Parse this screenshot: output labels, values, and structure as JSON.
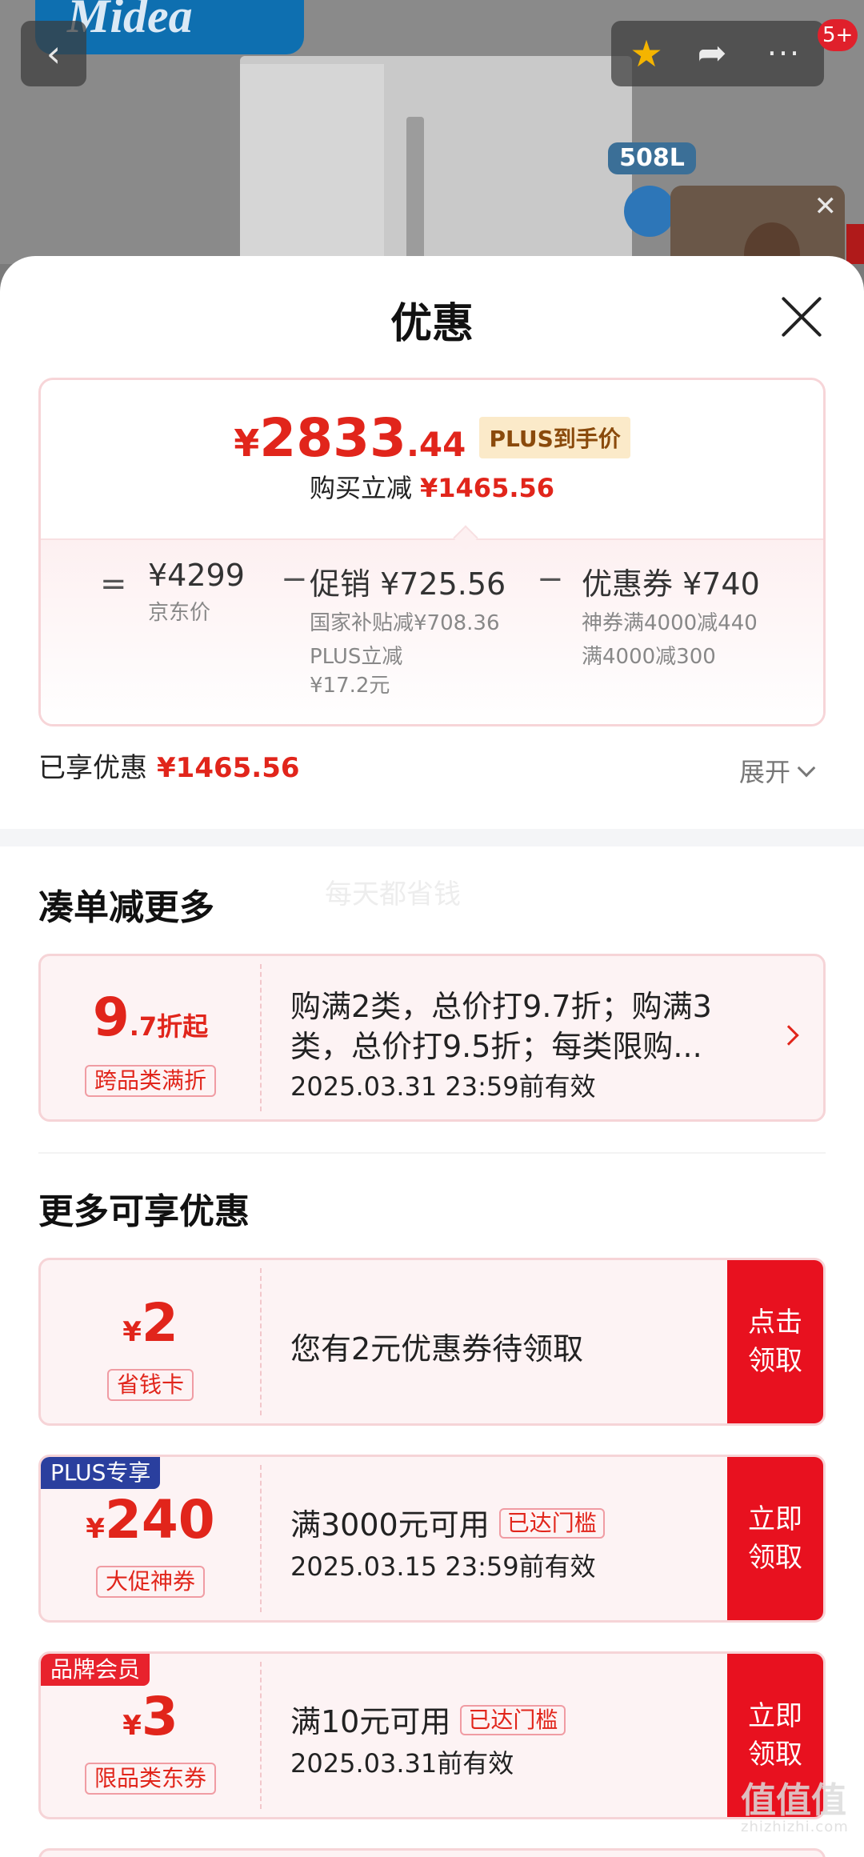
{
  "background": {
    "brand": "Midea",
    "capacity": "508L",
    "notification_count": "5+"
  },
  "sheet": {
    "title": "优惠",
    "price": {
      "symbol": "¥",
      "integer": "2833",
      "decimal": ".44",
      "plus_tag": "PLUS到手价",
      "reduce_label": "购买立减",
      "reduce_amount": "¥1465.56"
    },
    "breakdown": {
      "eq": "=",
      "minus": "−",
      "jd_price": "¥4299",
      "jd_label": "京东价",
      "promo_title": "促销 ¥725.56",
      "promo_details": [
        "国家补贴减¥708.36",
        "PLUS立减",
        "¥17.2元"
      ],
      "coupon_title": "优惠券 ¥740",
      "coupon_details": [
        "神券满4000减440",
        "满4000减300"
      ]
    },
    "enjoyed_label": "已享优惠",
    "enjoyed_amount": "¥1465.56",
    "expand_label": "展开"
  },
  "bundle": {
    "title": "凑单减更多",
    "watermark": "每天都省钱",
    "offer": {
      "value_big": "9",
      "value_small": ".7折起",
      "kind": "跨品类满折",
      "desc_line1": "购满2类，总价打9.7折；购满3",
      "desc_line2": "类，总价打9.5折；每类限购...",
      "validity": "2025.03.31 23:59前有效"
    }
  },
  "more": {
    "title": "更多可享优惠",
    "coupons": [
      {
        "tag": "",
        "symbol": "¥",
        "value": "2",
        "kind": "省钱卡",
        "desc": "您有2元优惠券待领取",
        "reached": "",
        "validity": "",
        "cta": "点击领取"
      },
      {
        "tag": "PLUS专享",
        "symbol": "¥",
        "value": "240",
        "kind": "大促神券",
        "desc": "满3000元可用",
        "reached": "已达门槛",
        "validity": "2025.03.15 23:59前有效",
        "cta": "立即领取"
      },
      {
        "tag": "品牌会员",
        "symbol": "¥",
        "value": "3",
        "kind": "限品类东券",
        "desc": "满10元可用",
        "reached": "已达门槛",
        "validity": "2025.03.31前有效",
        "cta": "立即领取"
      }
    ]
  },
  "site_mark": {
    "cn": "值值值",
    "en": "zhizhizhi.com"
  },
  "colors": {
    "accent": "#e1251b",
    "cta": "#e8111f",
    "plus_tag_bg": "#fbeac9",
    "plus_corner": "#2a3f9e",
    "brand_corner": "#e8222d"
  }
}
